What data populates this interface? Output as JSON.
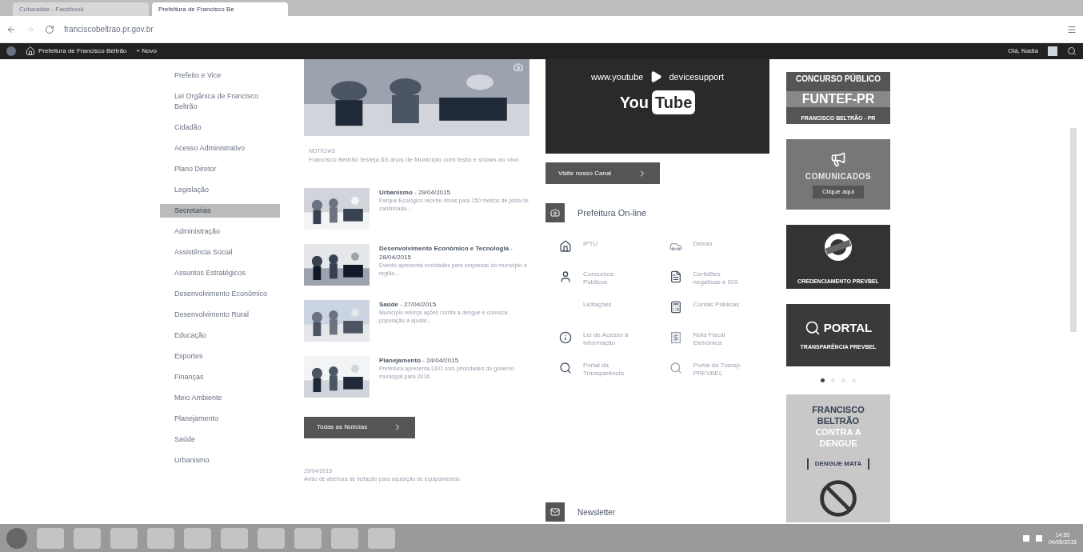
{
  "browser": {
    "tabs": [
      {
        "label": "Cutucadas - Facebook",
        "selected": false
      },
      {
        "label": "Prefeitura de Francisco Be",
        "selected": true
      }
    ],
    "address": "franciscobeltrao.pr.gov.br"
  },
  "admin_bar": {
    "site": "Prefeitura de Francisco Beltrão",
    "new": "+ Novo",
    "greeting": "Olá, Nadia"
  },
  "sidebar": {
    "items": [
      {
        "label": "Prefeito e Vice",
        "selected": false
      },
      {
        "label": "Lei Orgânica de Francisco Beltrão",
        "selected": false
      },
      {
        "label": "Cidadão",
        "selected": false
      },
      {
        "label": "Acesso Administrativo",
        "selected": false
      },
      {
        "label": "Plano Diretor",
        "selected": false
      },
      {
        "label": "Legislação",
        "selected": false
      },
      {
        "label": "Secretarias",
        "selected": true
      },
      {
        "label": "Administração",
        "selected": false
      },
      {
        "label": "Assistência Social",
        "selected": false
      },
      {
        "label": "Assuntos Estratégicos",
        "selected": false
      },
      {
        "label": "Desenvolvimento Econômico",
        "selected": false
      },
      {
        "label": "Desenvolvimento Rural",
        "selected": false
      },
      {
        "label": "Educação",
        "selected": false
      },
      {
        "label": "Esportes",
        "selected": false
      },
      {
        "label": "Finanças",
        "selected": false
      },
      {
        "label": "Meio Ambiente",
        "selected": false
      },
      {
        "label": "Planejamento",
        "selected": false
      },
      {
        "label": "Saúde",
        "selected": false
      },
      {
        "label": "Urbanismo",
        "selected": false
      }
    ]
  },
  "featured": {
    "label": "NOTÍCIAS",
    "text": "Francisco Beltrão festeja 63 anos de Município com festa e shows ao vivo"
  },
  "news": [
    {
      "category": "Urbanismo",
      "date": " - 29/04/2015",
      "summary": "Parque Ecológico recebe obras para 150 metros de pista de caminhada..."
    },
    {
      "category": "Desenvolvimento Econômico e Tecnologia",
      "date": " - 28/04/2015",
      "summary": "Evento apresenta novidades para empresas do município e região..."
    },
    {
      "category": "Saúde",
      "date": " - 27/04/2015",
      "summary": "Município reforça ações contra a dengue e convoca população a ajudar..."
    },
    {
      "category": "Planejamento",
      "date": " - 24/04/2015",
      "summary": "Prefeitura apresenta LDO com prioridades do governo municipal para 2016"
    }
  ],
  "all_news_button": "Todas as Notícias",
  "bottom_note": {
    "date": "29/04/2015",
    "text": "Aviso de abertura de licitação para aquisição de equipamentos"
  },
  "video": {
    "url_left": "www.youtube",
    "url_right": "devicesupport",
    "logo_left": "You",
    "logo_right": "Tube"
  },
  "channel_button": "Visite nosso Canal",
  "online": {
    "title": "Prefeitura On-line",
    "services": [
      {
        "kind": "house",
        "label": "IPTU"
      },
      {
        "kind": "car",
        "label": "Detran"
      },
      {
        "kind": "person",
        "label": "Concursos Públicos"
      },
      {
        "kind": "document",
        "label": "Certidões negativas e ISS"
      },
      {
        "kind": "none",
        "label": "Licitações"
      },
      {
        "kind": "calculator",
        "label": "Contas Públicas"
      },
      {
        "kind": "info",
        "label": "Lei de Acesso à Informação"
      },
      {
        "kind": "receipt",
        "label": "Nota Fiscal Eletrônica"
      },
      {
        "kind": "search",
        "label": "Portal da Transparência"
      },
      {
        "kind": "search-light",
        "label": "Portal da Transp. PREVBEL"
      }
    ]
  },
  "newsletter": "Newsletter",
  "banners": [
    {
      "kind": "contest",
      "lines": [
        "CONCURSO PÚBLICO",
        "FUNTEF-PR",
        "FRANCISCO BELTRÃO - PR"
      ]
    },
    {
      "kind": "notice",
      "lines": [
        "COMUNICADOS",
        "Clique aqui"
      ]
    },
    {
      "kind": "seal",
      "lines": [
        "CREDENCIAMENTO PREVBEL"
      ]
    },
    {
      "kind": "portal",
      "lines": [
        "PORTAL",
        "TRANSPARÊNCIA PREVBEL"
      ]
    }
  ],
  "carousel_dots": [
    {
      "selected": true
    },
    {
      "selected": false
    },
    {
      "selected": false
    },
    {
      "selected": false
    }
  ],
  "dengue": {
    "lines": [
      "FRANCISCO",
      "BELTRÃO",
      "CONTRA A",
      "DENGUE"
    ],
    "tag": "DENGUE MATA"
  },
  "taskbar": {
    "time": "14:55",
    "date": "04/05/2015"
  }
}
